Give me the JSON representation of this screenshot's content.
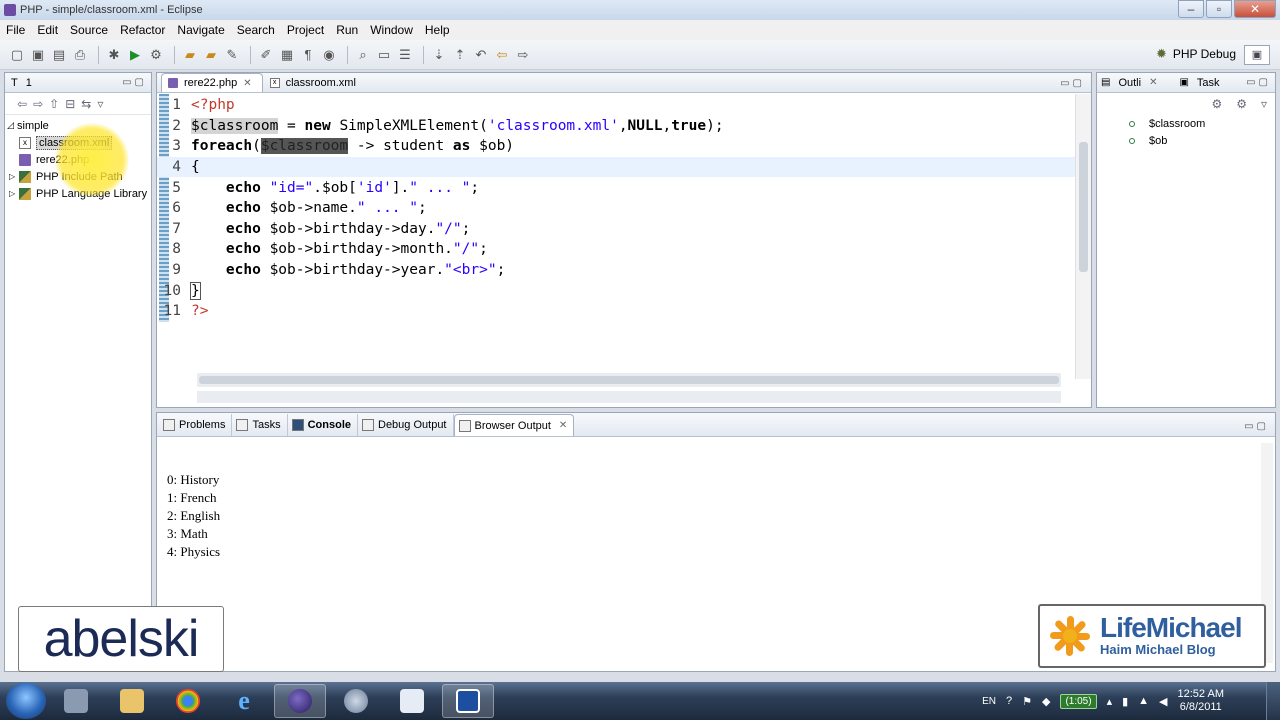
{
  "window": {
    "title": "PHP - simple/classroom.xml - Eclipse"
  },
  "menu": [
    "File",
    "Edit",
    "Source",
    "Refactor",
    "Navigate",
    "Search",
    "Project",
    "Run",
    "Window",
    "Help"
  ],
  "toolbar": {
    "perspective_label": "PHP Debug"
  },
  "navigator": {
    "tabs": [
      "T",
      "1"
    ],
    "tree": [
      {
        "label": "simple",
        "icon": "folder-icon",
        "level": 0
      },
      {
        "label": "classroom.xml",
        "icon": "xml-file-icon",
        "level": 1,
        "selected": true
      },
      {
        "label": "rere22.php",
        "icon": "php-file-icon",
        "level": 1
      },
      {
        "label": "PHP Include Path",
        "icon": "library-icon",
        "level": 1
      },
      {
        "label": "PHP Language Library",
        "icon": "library-icon",
        "level": 1
      }
    ]
  },
  "editor": {
    "tabs": [
      {
        "label": "rere22.php",
        "active": true
      },
      {
        "label": "classroom.xml",
        "active": false
      }
    ],
    "line_numbers": [
      "1",
      "2",
      "3",
      "4",
      "5",
      "6",
      "7",
      "8",
      "9",
      "10",
      "11"
    ],
    "code": {
      "l1": "<?php",
      "l2_var": "$classroom",
      "l2_eq": " = ",
      "l2_new": "new",
      "l2_cls": " SimpleXMLElement(",
      "l2_str": "'classroom.xml'",
      "l2_comma": ",",
      "l2_null": "NULL",
      "l2_comma2": ",",
      "l2_true": "true",
      "l2_end": ");",
      "l3_foreach": "foreach",
      "l3_open": "(",
      "l3_var": "$classroom",
      "l3_arrow": " -> student ",
      "l3_as": "as",
      "l3_end": " $ob)",
      "l4": "{",
      "l5_echo": "echo",
      "l5_s1": " \"id=\"",
      "l5_mid": ".$ob[",
      "l5_s2": "'id'",
      "l5_mid2": "].",
      "l5_s3": "\" ... \"",
      "l5_end": ";",
      "l6_echo": "echo",
      "l6_mid": " $ob->name.",
      "l6_s": "\" ... \"",
      "l6_end": ";",
      "l7_echo": "echo",
      "l7_mid": " $ob->birthday->day.",
      "l7_s": "\"/\"",
      "l7_end": ";",
      "l8_echo": "echo",
      "l8_mid": " $ob->birthday->month.",
      "l8_s": "\"/\"",
      "l8_end": ";",
      "l9_echo": "echo",
      "l9_mid": " $ob->birthday->year.",
      "l9_s": "\"<br>\"",
      "l9_end": ";",
      "l10": "}",
      "l11": "?>"
    }
  },
  "outline": {
    "tabs": [
      "Outli",
      "Task"
    ],
    "items": [
      "$classroom",
      "$ob"
    ]
  },
  "bottom": {
    "tabs": [
      "Problems",
      "Tasks",
      "Console",
      "Debug Output",
      "Browser Output"
    ],
    "active_tab": "Browser Output",
    "output": [
      "0: History",
      "1: French",
      "2: English",
      "3: Math",
      "4: Physics"
    ]
  },
  "overlays": {
    "left_logo": "abelski",
    "right_logo_name": "LifeMichael",
    "right_logo_sub": "Haim Michael Blog"
  },
  "taskbar": {
    "lang": "EN",
    "battery_badge": "(1:05)",
    "time": "12:52 AM",
    "date": "6/8/2011"
  }
}
